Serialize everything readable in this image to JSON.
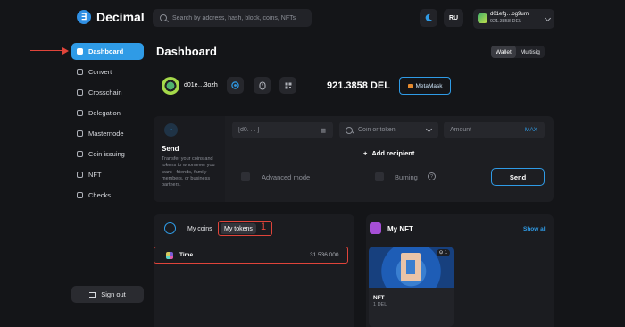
{
  "app": {
    "name": "Decimal",
    "logo_letter": "∃"
  },
  "search": {
    "placeholder": "Search by address, hash, block, coins, NFTs"
  },
  "header": {
    "language": "RU",
    "account_name": "d01efg…og9urn",
    "account_balance": "921.3858 DEL"
  },
  "sidebar": {
    "items": [
      {
        "label": "Dashboard",
        "icon": "home-icon",
        "active": true
      },
      {
        "label": "Convert",
        "icon": "swap-icon"
      },
      {
        "label": "Crosschain",
        "icon": "crosschain-icon"
      },
      {
        "label": "Delegation",
        "icon": "delegation-icon"
      },
      {
        "label": "Masternode",
        "icon": "server-icon"
      },
      {
        "label": "Coin issuing",
        "icon": "coin-icon"
      },
      {
        "label": "NFT",
        "icon": "nft-icon"
      },
      {
        "label": "Checks",
        "icon": "check-icon"
      }
    ],
    "sign_out": "Sign out"
  },
  "main": {
    "title": "Dashboard",
    "view_toggle": [
      "Wallet",
      "Multisig"
    ],
    "wallet_short": "d01e…3ozh",
    "balance": "921.3858 DEL",
    "metamask_label": "MetaMask"
  },
  "send": {
    "title": "Send",
    "description": "Transfer your coins and tokens to whomever you want - friends, family members, or business partners.",
    "address_placeholder": "[d0. . . ]",
    "coin_placeholder": "Coin or token",
    "amount_placeholder": "Amount",
    "max_label": "MAX",
    "add_recipient": "Add recipient",
    "advanced_mode": "Advanced mode",
    "burning": "Burning",
    "help_glyph": "?",
    "button": "Send"
  },
  "coins": {
    "tabs": [
      "My coins",
      "My tokens"
    ],
    "annotation_number": "1",
    "tokens": [
      {
        "name": "Time",
        "amount": "31 536 000"
      }
    ]
  },
  "nft": {
    "title": "My NFT",
    "show_all": "Show all",
    "items": [
      {
        "name": "NFT",
        "price": "1 DEL",
        "count": "1"
      }
    ]
  },
  "colors": {
    "accent": "#2f9be6",
    "annotation": "#e0443a",
    "background": "#141518"
  }
}
